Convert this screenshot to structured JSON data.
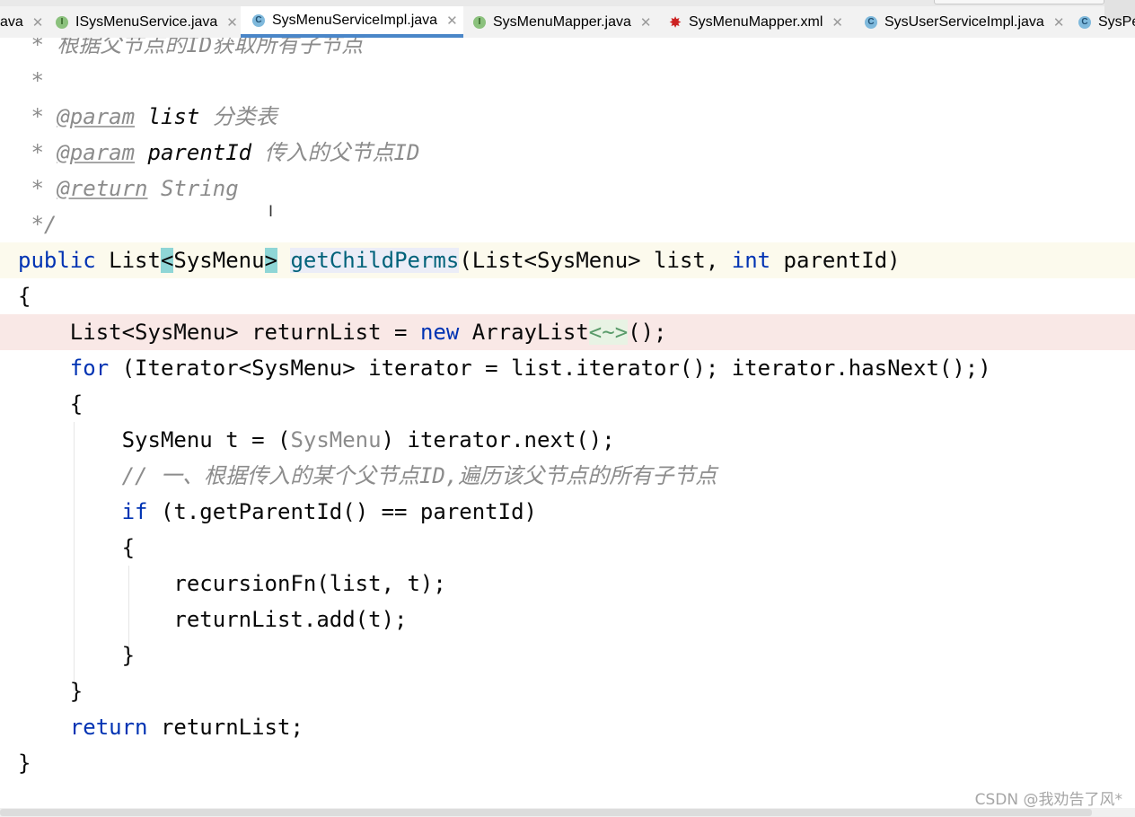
{
  "tabs": [
    {
      "label": "ava",
      "icon": "",
      "close": "✕",
      "active": false
    },
    {
      "label": "ISysMenuService.java",
      "icon": "I",
      "close": "✕",
      "active": false
    },
    {
      "label": "SysMenuServiceImpl.java",
      "icon": "C",
      "close": "✕",
      "active": true
    },
    {
      "label": "SysMenuMapper.java",
      "icon": "I",
      "close": "✕",
      "active": false
    },
    {
      "label": "SysMenuMapper.xml",
      "icon": "✸",
      "close": "✕",
      "active": false
    },
    {
      "label": "SysUserServiceImpl.java",
      "icon": "C",
      "close": "✕",
      "active": false
    },
    {
      "label": "SysPe",
      "icon": "C",
      "close": "",
      "active": false
    }
  ],
  "code_lines": [
    {
      "tokens": [
        {
          "k": "cm",
          "t": " * 根据父节点的ID获取所有子节点"
        }
      ]
    },
    {
      "tokens": [
        {
          "k": "cm",
          "t": " *"
        }
      ]
    },
    {
      "tokens": [
        {
          "k": "cm",
          "t": " * "
        },
        {
          "k": "tg",
          "t": "@param"
        },
        {
          "k": "cm",
          "t": " "
        },
        {
          "k": "pn",
          "t": "list"
        },
        {
          "k": "cm",
          "t": " 分类表"
        }
      ]
    },
    {
      "tokens": [
        {
          "k": "cm",
          "t": " * "
        },
        {
          "k": "tg",
          "t": "@param"
        },
        {
          "k": "cm",
          "t": " "
        },
        {
          "k": "pn",
          "t": "parentId"
        },
        {
          "k": "cm",
          "t": " 传入的父节点ID"
        }
      ]
    },
    {
      "tokens": [
        {
          "k": "cm",
          "t": " * "
        },
        {
          "k": "tg",
          "t": "@return"
        },
        {
          "k": "cm",
          "t": " String"
        }
      ]
    },
    {
      "tokens": [
        {
          "k": "cm",
          "t": " */"
        }
      ]
    },
    {
      "tokens": [
        {
          "k": "kw",
          "t": "public"
        },
        {
          "k": "p",
          "t": " List"
        },
        {
          "k": "bm",
          "t": "<"
        },
        {
          "k": "p",
          "t": "SysMenu"
        },
        {
          "k": "bm",
          "t": ">"
        },
        {
          "k": "p",
          "t": " "
        },
        {
          "k": "fn dm",
          "t": "getChildPerms"
        },
        {
          "k": "p",
          "t": "(List<SysMenu> list, "
        },
        {
          "k": "kw",
          "t": "int"
        },
        {
          "k": "p",
          "t": " parentId)"
        }
      ]
    },
    {
      "tokens": [
        {
          "k": "p",
          "t": "{"
        }
      ]
    },
    {
      "tokens": [
        {
          "k": "p",
          "t": "    List<SysMenu> returnList = "
        },
        {
          "k": "kw",
          "t": "new"
        },
        {
          "k": "p",
          "t": " ArrayList"
        },
        {
          "k": "dia",
          "t": "<~>"
        },
        {
          "k": "p",
          "t": "();"
        }
      ]
    },
    {
      "tokens": [
        {
          "k": "p",
          "t": "    "
        },
        {
          "k": "kw",
          "t": "for"
        },
        {
          "k": "p",
          "t": " (Iterator<SysMenu> iterator = list.iterator(); iterator.hasNext();)"
        }
      ]
    },
    {
      "tokens": [
        {
          "k": "p",
          "t": "    {"
        }
      ]
    },
    {
      "tokens": [
        {
          "k": "p",
          "t": "        SysMenu t = ("
        },
        {
          "k": "gray",
          "t": "SysMenu"
        },
        {
          "k": "p",
          "t": ") iterator.next();"
        }
      ]
    },
    {
      "tokens": [
        {
          "k": "p",
          "t": "        "
        },
        {
          "k": "cm",
          "t": "// 一、根据传入的某个父节点ID,遍历该父节点的所有子节点"
        }
      ]
    },
    {
      "tokens": [
        {
          "k": "p",
          "t": "        "
        },
        {
          "k": "kw",
          "t": "if"
        },
        {
          "k": "p",
          "t": " (t.getParentId() == parentId)"
        }
      ]
    },
    {
      "tokens": [
        {
          "k": "p",
          "t": "        {"
        }
      ]
    },
    {
      "tokens": [
        {
          "k": "p",
          "t": "            recursionFn(list, t);"
        }
      ]
    },
    {
      "tokens": [
        {
          "k": "p",
          "t": "            returnList.add(t);"
        }
      ]
    },
    {
      "tokens": [
        {
          "k": "p",
          "t": "        }"
        }
      ]
    },
    {
      "tokens": [
        {
          "k": "p",
          "t": "    }"
        }
      ]
    },
    {
      "tokens": [
        {
          "k": "p",
          "t": "    "
        },
        {
          "k": "kw",
          "t": "return"
        },
        {
          "k": "p",
          "t": " returnList;"
        }
      ]
    },
    {
      "tokens": [
        {
          "k": "p",
          "t": "}"
        }
      ]
    }
  ],
  "watermark": "CSDN @我劝告了风*"
}
